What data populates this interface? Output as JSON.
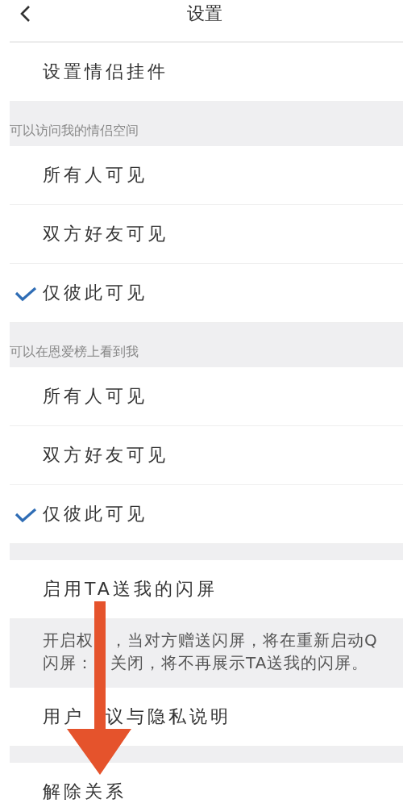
{
  "header": {
    "title": "设置"
  },
  "blocks": [
    {
      "kind": "row",
      "parts": [
        "设置情侣挂件"
      ]
    },
    {
      "kind": "group_header",
      "text": "可以访问我的情侣空间"
    },
    {
      "kind": "option",
      "label": "所有人可见",
      "selected": false
    },
    {
      "kind": "option",
      "label": "双方好友可见",
      "selected": false
    },
    {
      "kind": "option",
      "label": "仅彼此可见",
      "selected": true
    },
    {
      "kind": "group_header",
      "text": "可以在恩爱榜上看到我"
    },
    {
      "kind": "option",
      "label": "所有人可见",
      "selected": false
    },
    {
      "kind": "option",
      "label": "双方好友可见",
      "selected": false
    },
    {
      "kind": "option",
      "label": "仅彼此可见",
      "selected": true
    },
    {
      "kind": "spacer"
    },
    {
      "kind": "row",
      "parts": [
        "启用TA送我的闪屏"
      ]
    },
    {
      "kind": "note",
      "lines": [
        [
          "开启权",
          "，当对方赠送闪屏，将在重新启动Q"
        ],
        [
          "闪屏：",
          "关闭，将不再展示TA送我的闪屏。"
        ]
      ]
    },
    {
      "kind": "row",
      "parts": [
        "用户",
        "议与隐私说明"
      ]
    },
    {
      "kind": "spacer"
    },
    {
      "kind": "row",
      "parts": [
        "解除关系"
      ]
    }
  ]
}
